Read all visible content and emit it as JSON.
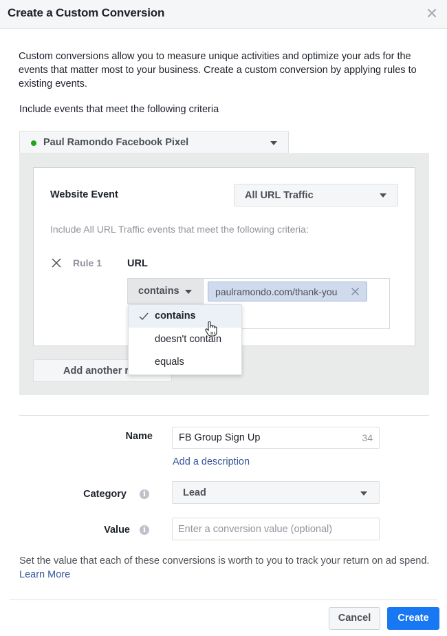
{
  "dialog": {
    "title": "Create a Custom Conversion",
    "close_icon": "close-icon"
  },
  "intro": "Custom conversions allow you to measure unique activities and optimize your ads for the events that matter most to your business. Create a custom conversion by applying rules to existing events.",
  "criteria_label": "Include events that meet the following criteria",
  "pixel": {
    "name": "Paul Ramondo Facebook Pixel",
    "status_color": "#1fa51f"
  },
  "website_event": {
    "label": "Website Event",
    "selected": "All URL Traffic"
  },
  "include_hint": "Include All URL Traffic events that meet the following criteria:",
  "rule": {
    "label": "Rule 1",
    "field": "URL",
    "condition": "contains",
    "token": "paulramondo.com/thank-you",
    "condition_menu": [
      {
        "label": "contains",
        "selected": true
      },
      {
        "label": "doesn't contain",
        "selected": false
      },
      {
        "label": "equals",
        "selected": false
      }
    ]
  },
  "add_rule_button": "Add another rule",
  "name_field": {
    "label": "Name",
    "value": "FB Group Sign Up",
    "remaining_chars": "34",
    "add_description": "Add a description"
  },
  "category_field": {
    "label": "Category",
    "selected": "Lead"
  },
  "value_field": {
    "label": "Value",
    "placeholder": "Enter a conversion value (optional)"
  },
  "value_hint": "Set the value that each of these conversions is worth to you to track your return on ad spend.",
  "learn_more": "Learn More",
  "footer": {
    "cancel": "Cancel",
    "create": "Create"
  },
  "colors": {
    "primary": "#1877f2",
    "link": "#365899",
    "token_bg": "#cfdaed"
  }
}
